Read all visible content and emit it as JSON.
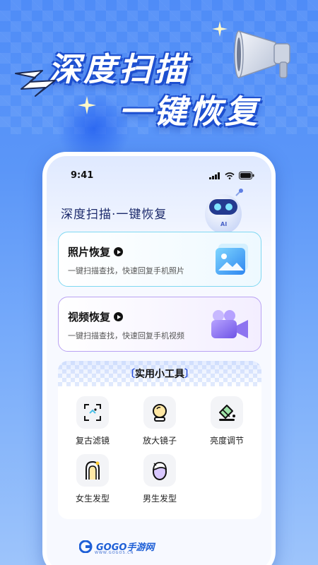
{
  "promo": {
    "headline_line1": "深度扫描",
    "headline_line2": "一键恢复"
  },
  "phone": {
    "status_time": "9:41",
    "app_title": "深度扫描·一键恢复",
    "robot_badge": "AI",
    "cards": [
      {
        "title": "照片恢复",
        "desc": "一键扫描查找，快速回复手机照片",
        "icon": "photo-icon",
        "accent": "#7fd8f2"
      },
      {
        "title": "视频恢复",
        "desc": "一键扫描查找，快速回复手机视频",
        "icon": "video-camera-icon",
        "accent": "#b9a2f3"
      }
    ],
    "tools": {
      "title": "实用小工具",
      "items": [
        {
          "label": "复古滤镜",
          "icon": "retro-filter-icon"
        },
        {
          "label": "放大镜子",
          "icon": "magnifier-mirror-icon"
        },
        {
          "label": "亮度调节",
          "icon": "brightness-icon"
        },
        {
          "label": "女生发型",
          "icon": "female-hairstyle-icon"
        },
        {
          "label": "男生发型",
          "icon": "male-hairstyle-icon"
        }
      ]
    }
  },
  "footer": {
    "logo_text": "GOGO手游网",
    "logo_sub": "WWW.GOGOS.CN"
  },
  "colors": {
    "background": "#5b96f8",
    "headline_shadow": "#1d4fcf",
    "photo_card_border": "#7fd8f2",
    "video_card_border": "#b9a2f3"
  }
}
